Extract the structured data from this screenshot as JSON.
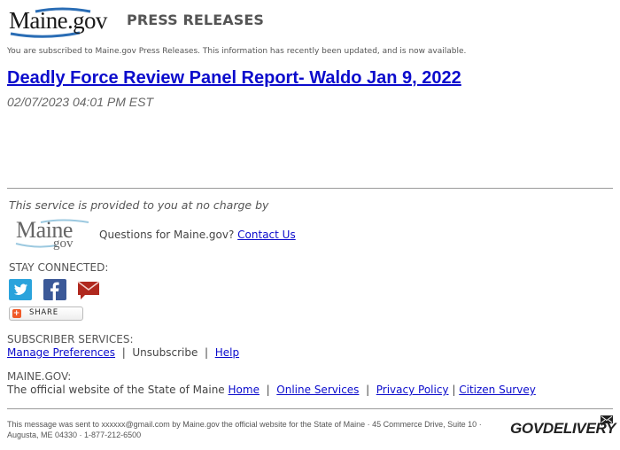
{
  "header": {
    "logo": "Maine.gov",
    "title": "PRESS RELEASES",
    "subscribed_notice": "You are subscribed to Maine.gov Press Releases. This information has recently been updated, and is now available."
  },
  "article": {
    "headline": "Deadly Force Review Panel Report- Waldo Jan 9, 2022",
    "datetime": "02/07/2023 04:01 PM EST"
  },
  "provider": {
    "text": "This service is provided to you at no charge by",
    "logo_main": "Maine",
    "logo_sub": "gov",
    "questions": "Questions for Maine.gov?",
    "contact_link": "Contact Us"
  },
  "social": {
    "heading": "STAY CONNECTED:",
    "icons": [
      "twitter-icon",
      "facebook-icon",
      "email-icon"
    ],
    "share_label": "SHARE"
  },
  "subscriber_services": {
    "heading": "SUBSCRIBER SERVICES:",
    "manage": "Manage Preferences",
    "unsubscribe": "Unsubscribe",
    "help": "Help",
    "separator": "|"
  },
  "maine_gov": {
    "heading": "MAINE.GOV:",
    "description": "The official website of the State of Maine",
    "links": [
      "Home",
      "Online Services",
      "Privacy Policy",
      "Citizen Survey"
    ]
  },
  "footer": {
    "message": "This message was sent to xxxxxx@gmail.com by Maine.gov the official website for the State of Maine · 45 Commerce Drive, Suite 10 · Augusta, ME 04330 · 1-877-212-6500",
    "brand": "GOVDELIVERY"
  },
  "colors": {
    "link": "#0b0bcc",
    "twitter": "#2aa3dc",
    "facebook": "#3b5998",
    "email": "#b0281e",
    "share_plus": "#f05a28"
  }
}
